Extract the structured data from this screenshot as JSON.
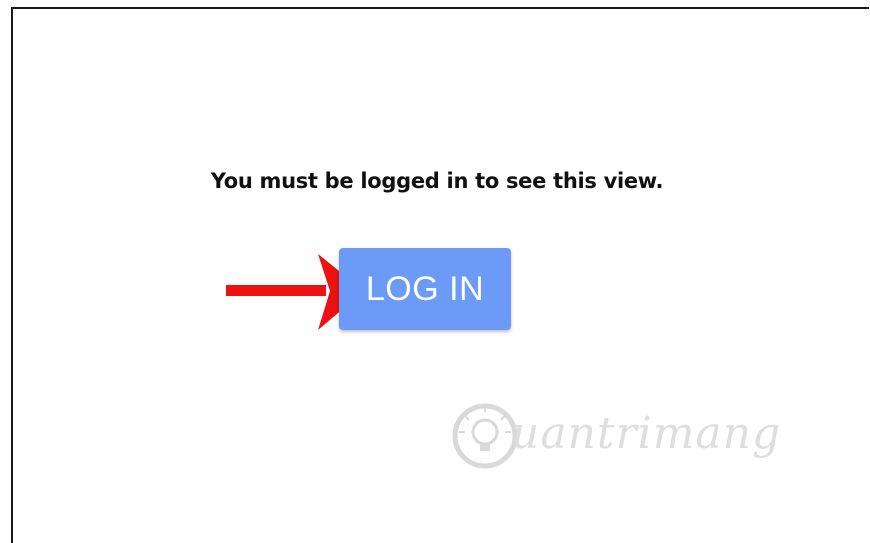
{
  "page": {
    "message": "You must be logged in to see this view.",
    "login_button_label": "LOG IN"
  },
  "annotation": {
    "arrow_color": "#ee1111"
  },
  "watermark": {
    "text": "uantrimang",
    "icon": "lightbulb-icon"
  },
  "colors": {
    "button_bg": "#6b9bf7",
    "button_text": "#ffffff",
    "message_text": "#111111"
  }
}
